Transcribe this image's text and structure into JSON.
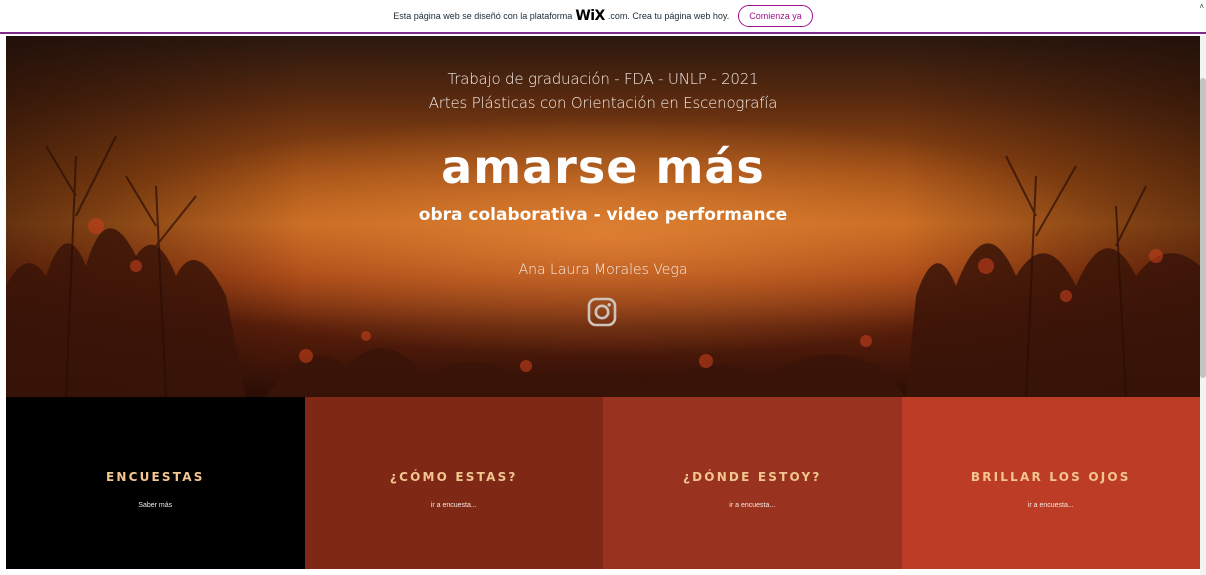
{
  "banner": {
    "text_before": "Esta página web se diseñó con la plataforma",
    "logo": "WiX",
    "text_after": ".com. Crea tu página web hoy.",
    "cta_label": "Comienza ya",
    "accent": "#a0138e",
    "edge_glyph": "˄"
  },
  "hero": {
    "line1": "Trabajo de graduación - FDA - UNLP - 2021",
    "line2": "Artes Plásticas con Orientación en Escenografía",
    "title": "amarse más",
    "subtitle": "obra colaborativa - video performance",
    "author": "Ana Laura Morales Vega",
    "social_icon": "instagram-icon"
  },
  "surveys": {
    "panels": [
      {
        "title": "ENCUESTAS",
        "link": "Saber más",
        "color": "#000000"
      },
      {
        "title": "¿CÓMO ESTAS?",
        "link": "ir a encuesta...",
        "color": "#7f2816"
      },
      {
        "title": "¿DÓNDE ESTOY?",
        "link": "ir a encuesta...",
        "color": "#9a3220"
      },
      {
        "title": "BRILLAR LOS OJOS",
        "link": "ir a encuesta...",
        "color": "#bd3c25"
      }
    ],
    "title_color": "#f2c68e"
  }
}
